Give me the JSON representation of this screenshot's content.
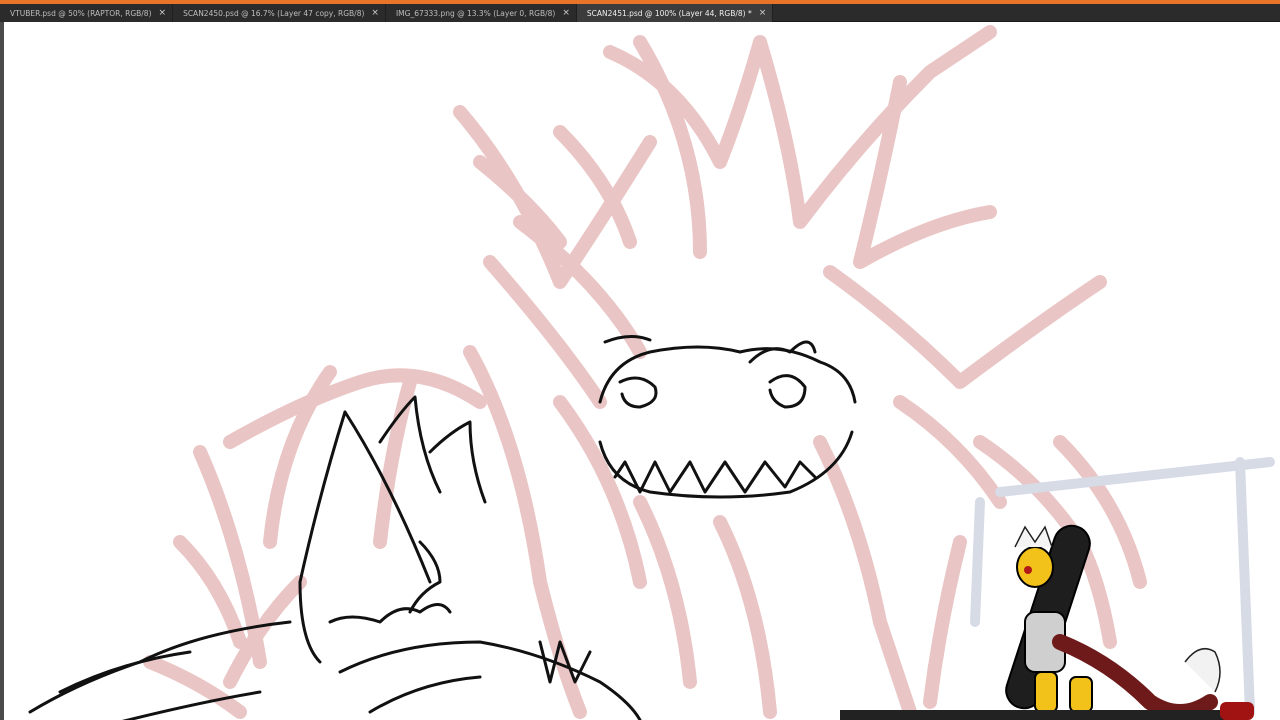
{
  "app": {
    "accent_color": "#e8742a",
    "canvas_color": "#ffffff",
    "sketch_color": "#e9c2c2",
    "lineart_color": "#111111"
  },
  "tabs": [
    {
      "label": "VTUBER.psd @ 50% (RAPTOR, RGB/8)",
      "close": "×",
      "active": false
    },
    {
      "label": "SCAN2450.psd @ 16.7% (Layer 47 copy, RGB/8)",
      "close": "×",
      "active": false
    },
    {
      "label": "IMG_67333.png @ 13.3% (Layer 0, RGB/8)",
      "close": "×",
      "active": false
    },
    {
      "label": "SCAN2451.psd @ 100% (Layer 44, RGB/8) *",
      "close": "×",
      "active": true
    }
  ]
}
